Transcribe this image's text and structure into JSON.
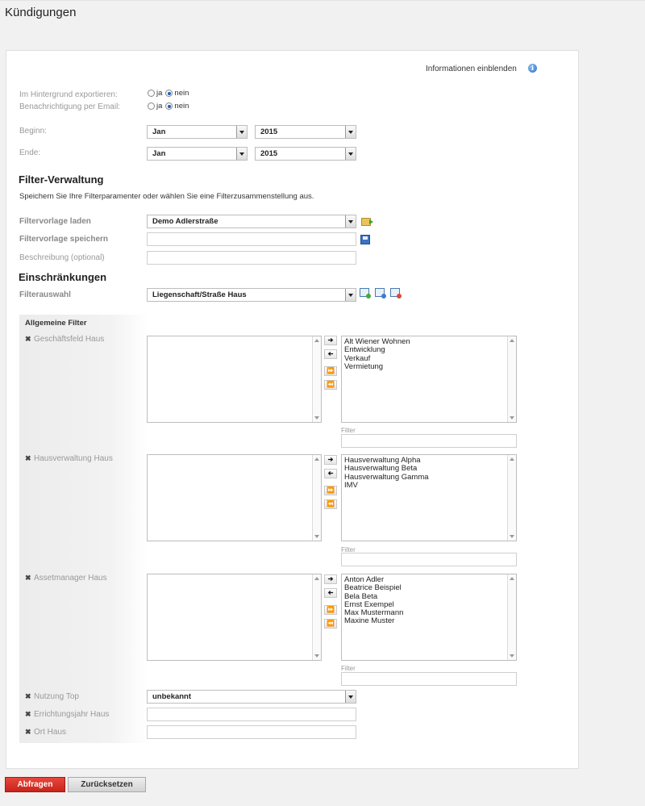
{
  "page": {
    "title": "Kündigungen"
  },
  "header": {
    "info_link": "Informationen einblenden",
    "info_icon": "info-icon"
  },
  "export_bg": {
    "label": "Im Hintergrund exportieren:",
    "yes": "ja",
    "no": "nein",
    "selected": "nein"
  },
  "notify_email": {
    "label": "Benachrichtigung per Email:",
    "yes": "ja",
    "no": "nein",
    "selected": "nein"
  },
  "begin": {
    "label": "Beginn:",
    "month": "Jan",
    "year": "2015"
  },
  "end": {
    "label": "Ende:",
    "month": "Jan",
    "year": "2015"
  },
  "filter_mgmt": {
    "heading": "Filter-Verwaltung",
    "description": "Speichern Sie Ihre Filterparamenter oder wählen Sie eine Filterzusammenstellung aus.",
    "load_label": "Filtervorlage laden",
    "load_value": "Demo Adlerstraße",
    "save_label": "Filtervorlage speichern",
    "save_value": "",
    "desc_label": "Beschreibung (optional)",
    "desc_value": ""
  },
  "restrictions": {
    "heading": "Einschränkungen",
    "select_label": "Filterauswahl",
    "select_value": "Liegenschaft/Straße Haus"
  },
  "general_filters": {
    "heading": "Allgemeine Filter",
    "move_buttons": {
      "right": "➔",
      "left": "➔",
      "all_right": "⏩",
      "all_left": "⏪"
    },
    "filter_label": "Filter",
    "lists": [
      {
        "label": "Geschäftsfeld Haus",
        "selected": [],
        "available": [
          "Alt Wiener Wohnen",
          "Entwicklung",
          "Verkauf",
          "Vermietung"
        ]
      },
      {
        "label": "Hausverwaltung Haus",
        "selected": [],
        "available": [
          "Hausverwaltung Alpha",
          "Hausverwaltung Beta",
          "Hausverwaltung Gamma",
          "IMV"
        ]
      },
      {
        "label": "Assetmanager Haus",
        "selected": [],
        "available": [
          "Anton Adler",
          "Beatrice Beispiel",
          "Bela Beta",
          "Ernst Exempel",
          "Max Mustermann",
          "Maxine Muster"
        ]
      }
    ],
    "usage": {
      "label": "Nutzung Top",
      "value": "unbekannt"
    },
    "year_built": {
      "label": "Errichtungsjahr Haus",
      "value": ""
    },
    "city": {
      "label": "Ort Haus",
      "value": ""
    }
  },
  "actions": {
    "submit": "Abfragen",
    "reset": "Zurücksetzen"
  },
  "colors": {
    "primary_button": "#d2302a",
    "link_icon": "#2a6fc4"
  }
}
